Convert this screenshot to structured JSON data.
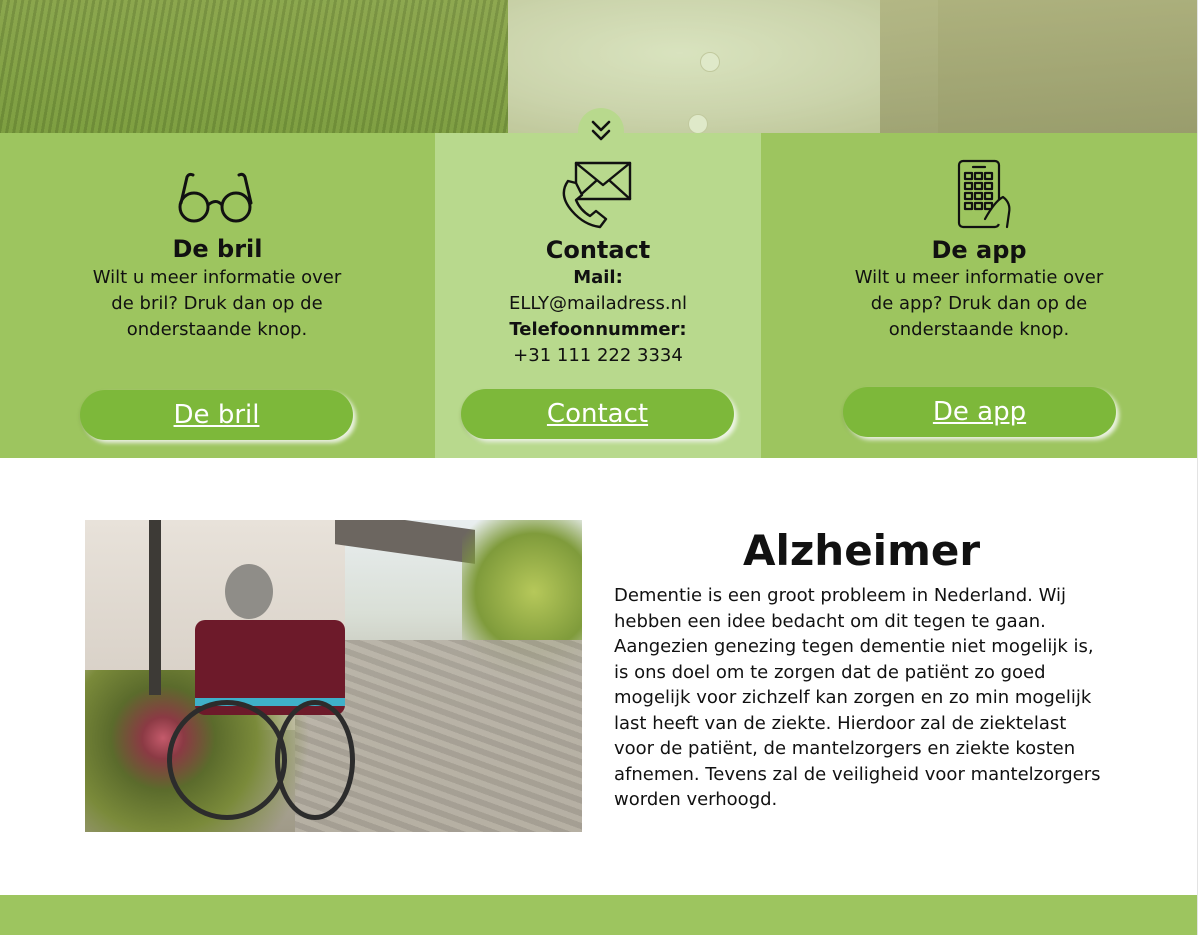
{
  "panels": [
    {
      "id": "bril",
      "icon": "glasses-icon",
      "title": "De bril",
      "text": "Wilt u meer informatie over de bril? Druk dan op de onderstaande knop.",
      "button_label": "De bril"
    },
    {
      "id": "contact",
      "icon": "envelope-phone-icon",
      "title": "Contact",
      "mail_label": "Mail:",
      "mail_value": "ELLY@mailadress.nl",
      "phone_label": "Telefoonnummer:",
      "phone_value": "+31 111 222 3334",
      "button_label": "Contact"
    },
    {
      "id": "app",
      "icon": "phone-app-icon",
      "title": "De app",
      "text": "Wilt u meer informatie over de app? Druk dan op de onderstaande knop.",
      "button_label": "De app"
    }
  ],
  "scroll_indicator_icon": "double-chevron-down-icon",
  "section": {
    "title": "Alzheimer",
    "body": "Dementie is een groot probleem in Nederland. Wij hebben een idee bedacht om dit tegen te gaan. Aangezien genezing tegen dementie niet mogelijk is, is ons doel om te zorgen dat de patiënt zo goed mogelijk voor zichzelf kan zorgen en zo min mogelijk last heeft van de ziekte. Hierdoor zal de ziektelast voor de patiënt, de mantelzorgers en ziekte kosten afnemen. Tevens zal de veiligheid voor mantelzorgers worden verhoogd."
  },
  "colors": {
    "panel_green": "#9dc55f",
    "panel_light_green": "#b8d98d",
    "button_green": "#7db83a",
    "footer_green": "#9dc55f"
  }
}
